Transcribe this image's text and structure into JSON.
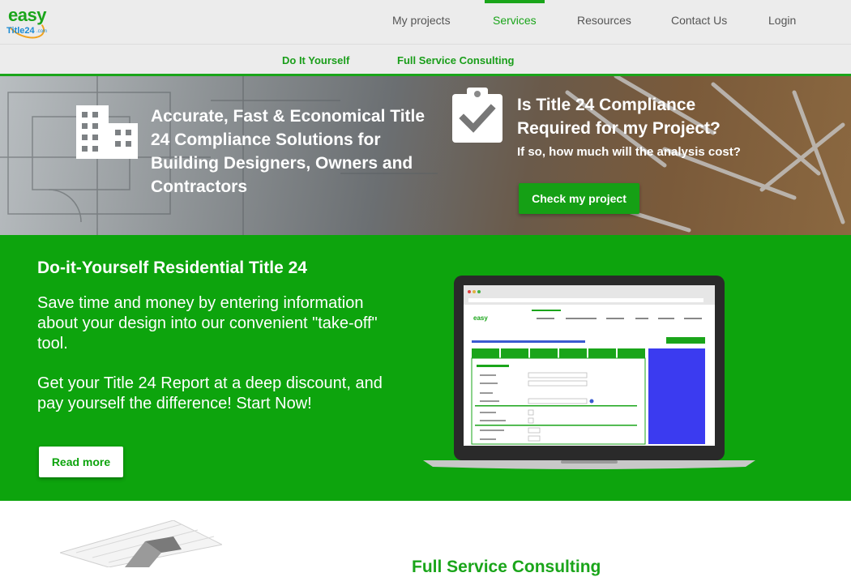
{
  "header": {
    "logo": {
      "line1": "easy",
      "line2": "Title24",
      "suffix": ".com"
    },
    "nav": [
      {
        "label": "My projects"
      },
      {
        "label": "Services"
      },
      {
        "label": "Resources"
      },
      {
        "label": "Contact Us"
      },
      {
        "label": "Login"
      }
    ],
    "active_nav": "Services"
  },
  "subnav": {
    "items": [
      {
        "label": "Do It Yourself"
      },
      {
        "label": "Full Service Consulting"
      }
    ]
  },
  "hero": {
    "left_heading": "Accurate, Fast & Economical Title 24 Compliance Solutions for Building Designers, Owners and Contractors",
    "right_heading": "Is Title 24 Compliance Required for my Project?",
    "right_sub": "If so, how much will the analysis cost?",
    "cta_label": "Check my project",
    "icons": [
      "building-icon",
      "clipboard-check-icon"
    ]
  },
  "diy": {
    "title": "Do-it-Yourself Residential Title 24",
    "paragraph1": "Save time and money by entering information about your design into our convenient \"take-off\" tool.",
    "paragraph2": "Get your Title 24 Report at a deep discount, and pay yourself the difference! Start Now!",
    "cta_label": "Read more"
  },
  "full_service": {
    "title": "Full Service Consulting"
  },
  "colors": {
    "brand_green": "#0da40d",
    "nav_gray": "#ececec",
    "logo_blue": "#1a8ad4",
    "logo_orange": "#f0a21e"
  }
}
